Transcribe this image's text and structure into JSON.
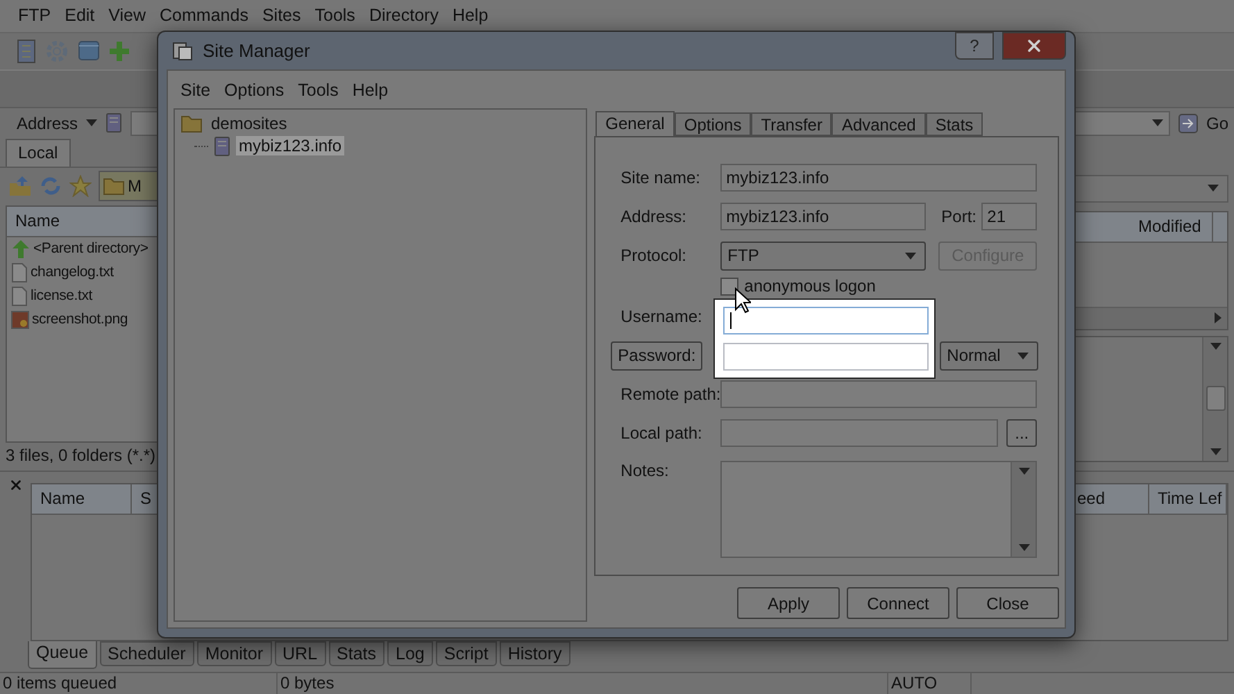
{
  "app": {
    "menu": [
      "FTP",
      "Edit",
      "View",
      "Commands",
      "Sites",
      "Tools",
      "Directory",
      "Help"
    ],
    "address_label": "Address",
    "go_button": "Go",
    "local_tab": "Local",
    "local_path": "M",
    "file_columns": [
      "Name"
    ],
    "files": [
      {
        "name": "<Parent directory>",
        "kind": "parent"
      },
      {
        "name": "changelog.txt",
        "kind": "text"
      },
      {
        "name": "license.txt",
        "kind": "text"
      },
      {
        "name": "screenshot.png",
        "kind": "image"
      }
    ],
    "local_status": "3 files, 0 folders (*.*)",
    "remote_columns": [
      "Modified"
    ],
    "queue_columns": [
      "Name",
      "S"
    ],
    "queue_columns_right": [
      "eed",
      "Time Lef"
    ],
    "bottom_tabs": [
      {
        "label": "Queue",
        "selected": true
      },
      {
        "label": "Scheduler",
        "selected": false
      },
      {
        "label": "Monitor",
        "selected": false
      },
      {
        "label": "URL",
        "selected": false
      },
      {
        "label": "Stats",
        "selected": false
      },
      {
        "label": "Log",
        "selected": false
      },
      {
        "label": "Script",
        "selected": false
      },
      {
        "label": "History",
        "selected": false
      }
    ],
    "status_bar": [
      "0 items queued",
      "0 bytes",
      "AUTO"
    ]
  },
  "site_manager": {
    "title": "Site Manager",
    "help_glyph": "?",
    "menu": [
      "Site",
      "Options",
      "Tools",
      "Help"
    ],
    "tree": [
      {
        "label": "demosites",
        "selected": false,
        "children": [
          {
            "label": "mybiz123.info",
            "selected": true
          }
        ]
      }
    ],
    "tabs": [
      {
        "label": "General",
        "selected": true
      },
      {
        "label": "Options",
        "selected": false
      },
      {
        "label": "Transfer",
        "selected": false
      },
      {
        "label": "Advanced",
        "selected": false
      },
      {
        "label": "Stats",
        "selected": false
      }
    ],
    "form": {
      "site_name": {
        "label": "Site name:",
        "value": "mybiz123.info"
      },
      "address": {
        "label": "Address:",
        "value": "mybiz123.info"
      },
      "port": {
        "label": "Port:",
        "value": "21"
      },
      "protocol": {
        "label": "Protocol:",
        "value": "FTP"
      },
      "configure_button": {
        "label": "Configure",
        "disabled": true
      },
      "anonymous_logon": {
        "label": "anonymous logon",
        "checked": false
      },
      "username": {
        "label": "Username:",
        "focused": true
      },
      "password_button": "Password:",
      "logon_type": "Normal",
      "remote_path": {
        "label": "Remote path:"
      },
      "local_path": {
        "label": "Local path:"
      },
      "browse_button": "...",
      "notes": {
        "label": "Notes:"
      }
    },
    "buttons": [
      "Apply",
      "Connect",
      "Close"
    ]
  }
}
